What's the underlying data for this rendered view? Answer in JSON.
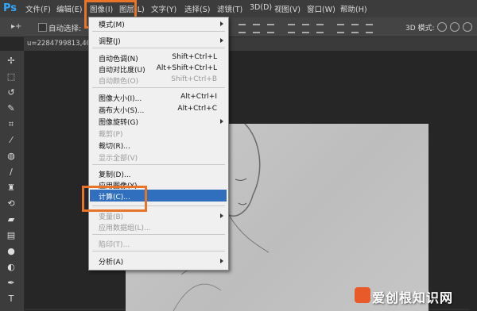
{
  "app": {
    "logo": "Ps"
  },
  "menubar": {
    "items": [
      "文件(F)",
      "编辑(E)",
      "图像(I)",
      "图层(L)",
      "文字(Y)",
      "选择(S)",
      "滤镜(T)",
      "3D(D)",
      "视图(V)",
      "窗口(W)",
      "帮助(H)"
    ]
  },
  "options": {
    "auto_select": "自动选择:",
    "mode3d": "3D 模式:"
  },
  "tab": {
    "label": "u=2284799813,40"
  },
  "dropdown": {
    "items": [
      {
        "label": "模式(M)",
        "shortcut": "",
        "disabled": false,
        "submenu": true
      },
      {
        "label": "调整(J)",
        "shortcut": "",
        "disabled": false,
        "submenu": true
      },
      {
        "label": "自动色调(N)",
        "shortcut": "Shift+Ctrl+L",
        "disabled": false
      },
      {
        "label": "自动对比度(U)",
        "shortcut": "Alt+Shift+Ctrl+L",
        "disabled": false
      },
      {
        "label": "自动颜色(O)",
        "shortcut": "Shift+Ctrl+B",
        "disabled": true
      },
      {
        "label": "图像大小(I)...",
        "shortcut": "Alt+Ctrl+I",
        "disabled": false
      },
      {
        "label": "画布大小(S)...",
        "shortcut": "Alt+Ctrl+C",
        "disabled": false
      },
      {
        "label": "图像旋转(G)",
        "shortcut": "",
        "disabled": false,
        "submenu": true
      },
      {
        "label": "裁剪(P)",
        "shortcut": "",
        "disabled": true
      },
      {
        "label": "裁切(R)...",
        "shortcut": "",
        "disabled": false
      },
      {
        "label": "显示全部(V)",
        "shortcut": "",
        "disabled": true
      },
      {
        "label": "复制(D)...",
        "shortcut": "",
        "disabled": false
      },
      {
        "label": "应用图像(Y)...",
        "shortcut": "",
        "disabled": false
      },
      {
        "label": "计算(C)...",
        "shortcut": "",
        "disabled": false,
        "active": true
      },
      {
        "label": "变量(B)",
        "shortcut": "",
        "disabled": true,
        "submenu": true
      },
      {
        "label": "应用数据组(L)...",
        "shortcut": "",
        "disabled": true
      },
      {
        "label": "陷印(T)...",
        "shortcut": "",
        "disabled": true
      },
      {
        "label": "分析(A)",
        "shortcut": "",
        "disabled": false,
        "submenu": true
      }
    ]
  },
  "watermark": {
    "text": "爱创根知识网"
  },
  "colors": {
    "accent": "#e8742a",
    "highlight": "#2f6fbd",
    "ps_blue": "#31a8ff"
  }
}
